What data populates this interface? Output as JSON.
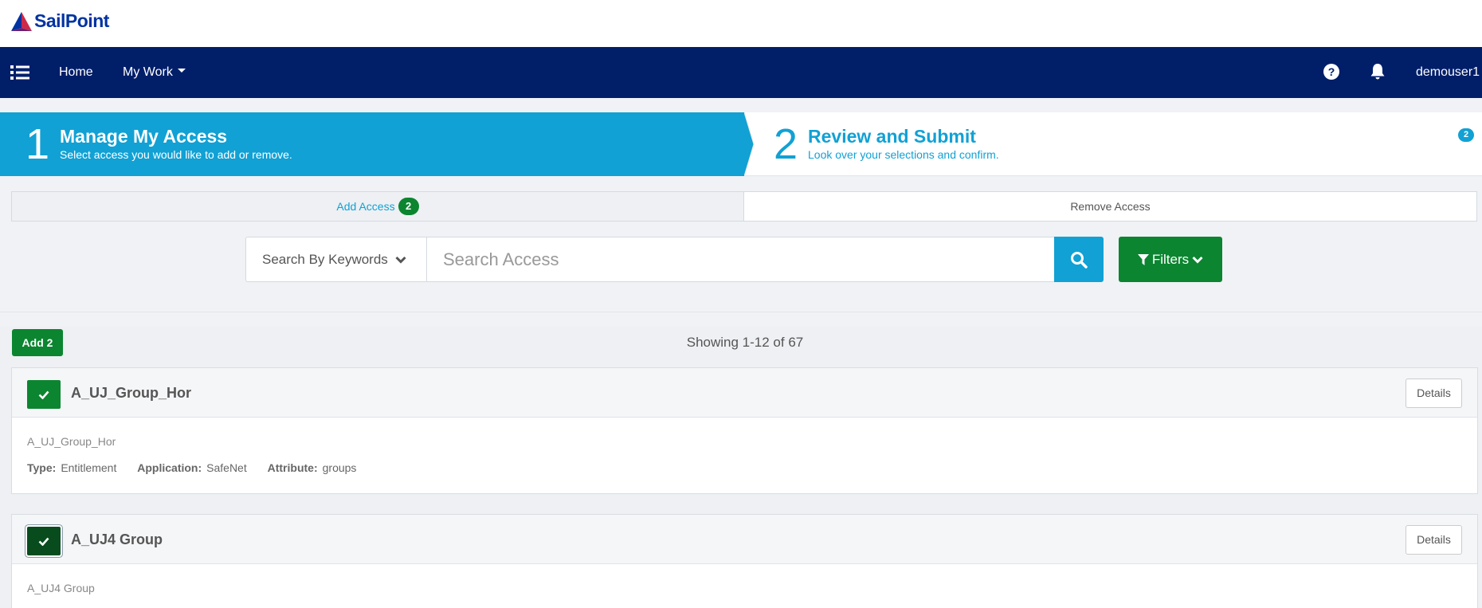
{
  "brand": {
    "name": "SailPoint"
  },
  "nav": {
    "home": "Home",
    "my_work": "My Work",
    "user": "demouser1"
  },
  "wizard": {
    "step1": {
      "number": "1",
      "title": "Manage My Access",
      "subtitle": "Select access you would like to add or remove."
    },
    "step2": {
      "number": "2",
      "title": "Review and Submit",
      "subtitle": "Look over your selections and confirm.",
      "badge": "2"
    }
  },
  "tabs": {
    "add": {
      "label": "Add Access",
      "badge": "2"
    },
    "remove": {
      "label": "Remove Access"
    }
  },
  "search": {
    "type": "Search By Keywords",
    "placeholder": "Search Access",
    "value": "",
    "filters": "Filters"
  },
  "results": {
    "add_button": "Add 2",
    "showing": "Showing 1-12 of 67",
    "items": [
      {
        "title": "A_UJ_Group_Hor",
        "description": "A_UJ_Group_Hor",
        "type_label": "Type:",
        "type": "Entitlement",
        "application_label": "Application:",
        "application": "SafeNet",
        "attribute_label": "Attribute:",
        "attribute": "groups",
        "details": "Details",
        "selected": true
      },
      {
        "title": "A_UJ4 Group",
        "description": "A_UJ4 Group",
        "details": "Details",
        "selected": true
      }
    ]
  },
  "colors": {
    "navbar": "#011e69",
    "accent": "#11a1d4",
    "green": "#0b8530",
    "dark_green": "#084c1e"
  },
  "icons": [
    "list-menu-icon",
    "help-circle-icon",
    "bell-icon",
    "chevron-down-icon",
    "search-icon",
    "filter-icon",
    "check-icon"
  ]
}
